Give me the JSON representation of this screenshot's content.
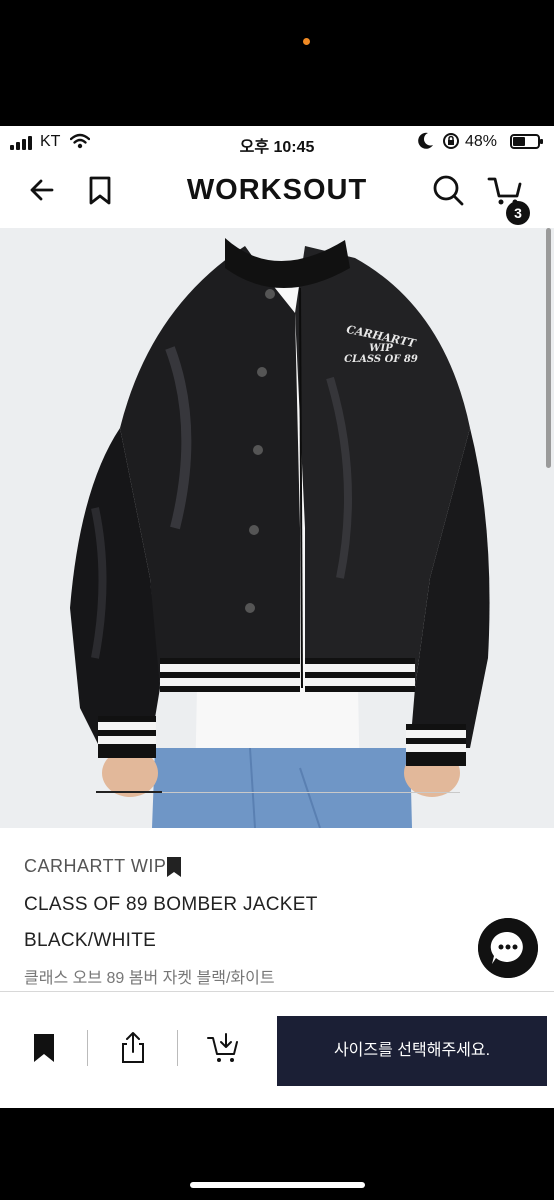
{
  "status_bar": {
    "carrier": "KT",
    "time": "오후 10:45",
    "battery_percent": "48%",
    "battery_level": 0.48
  },
  "header": {
    "brand": "WORKSOUT",
    "cart_count": "3",
    "icons": [
      "back-arrow-icon",
      "bookmark-icon",
      "search-icon",
      "cart-icon"
    ]
  },
  "product_image": {
    "patch_lines": [
      "CARHARTT",
      "WIP",
      "CLASS OF 89"
    ],
    "carousel_position": 0.18
  },
  "product": {
    "brand": "CARHARTT WIP",
    "name": "CLASS OF 89 BOMBER JACKET",
    "color": "BLACK/WHITE",
    "name_kr": "클래스 오브 89 봄버 자켓 블랙/화이트"
  },
  "bottom_bar": {
    "size_button_label": "사이즈를 선택해주세요.",
    "icons": [
      "bookmark-filled-icon",
      "share-icon",
      "add-to-cart-icon"
    ]
  },
  "colors": {
    "accent_dark": "#1b1f35",
    "background": "#ffffff",
    "image_background": "#eceef0"
  }
}
